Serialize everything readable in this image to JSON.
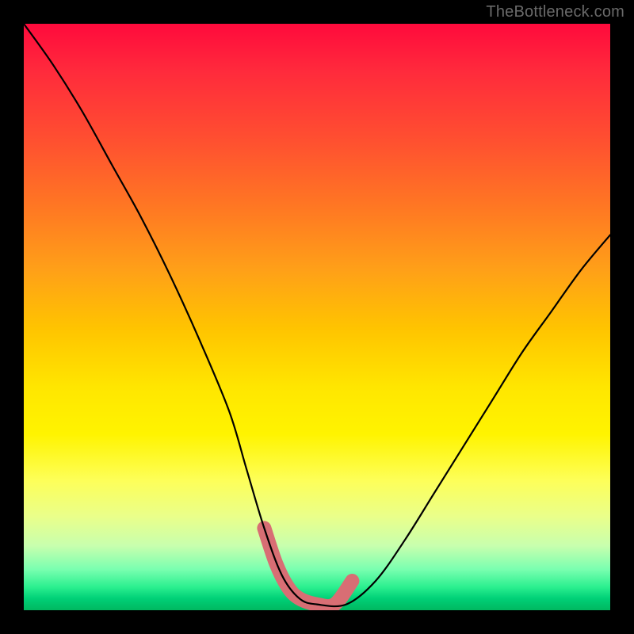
{
  "watermark": "TheBottleneck.com",
  "chart_data": {
    "type": "line",
    "title": "",
    "xlabel": "",
    "ylabel": "",
    "xlim": [
      0,
      100
    ],
    "ylim": [
      0,
      100
    ],
    "grid": false,
    "legend": false,
    "background": "red-yellow-green vertical gradient",
    "series": [
      {
        "name": "bottleneck-curve",
        "x": [
          0,
          5,
          10,
          15,
          20,
          25,
          30,
          35,
          38,
          41,
          44,
          47,
          50,
          55,
          60,
          65,
          70,
          75,
          80,
          85,
          90,
          95,
          100
        ],
        "values": [
          100,
          93,
          85,
          76,
          67,
          57,
          46,
          34,
          24,
          14,
          6,
          2,
          1,
          1,
          5,
          12,
          20,
          28,
          36,
          44,
          51,
          58,
          64
        ]
      }
    ],
    "highlight_segment": {
      "name": "pink-marker",
      "x": [
        41,
        43,
        45,
        47,
        50,
        53,
        56
      ],
      "values": [
        14,
        8,
        4,
        2,
        1,
        1,
        5
      ]
    },
    "colors": {
      "curve": "#000000",
      "marker": "#d86e74",
      "gradient_top": "#ff0a3c",
      "gradient_mid": "#ffe600",
      "gradient_bottom": "#00b860"
    }
  }
}
